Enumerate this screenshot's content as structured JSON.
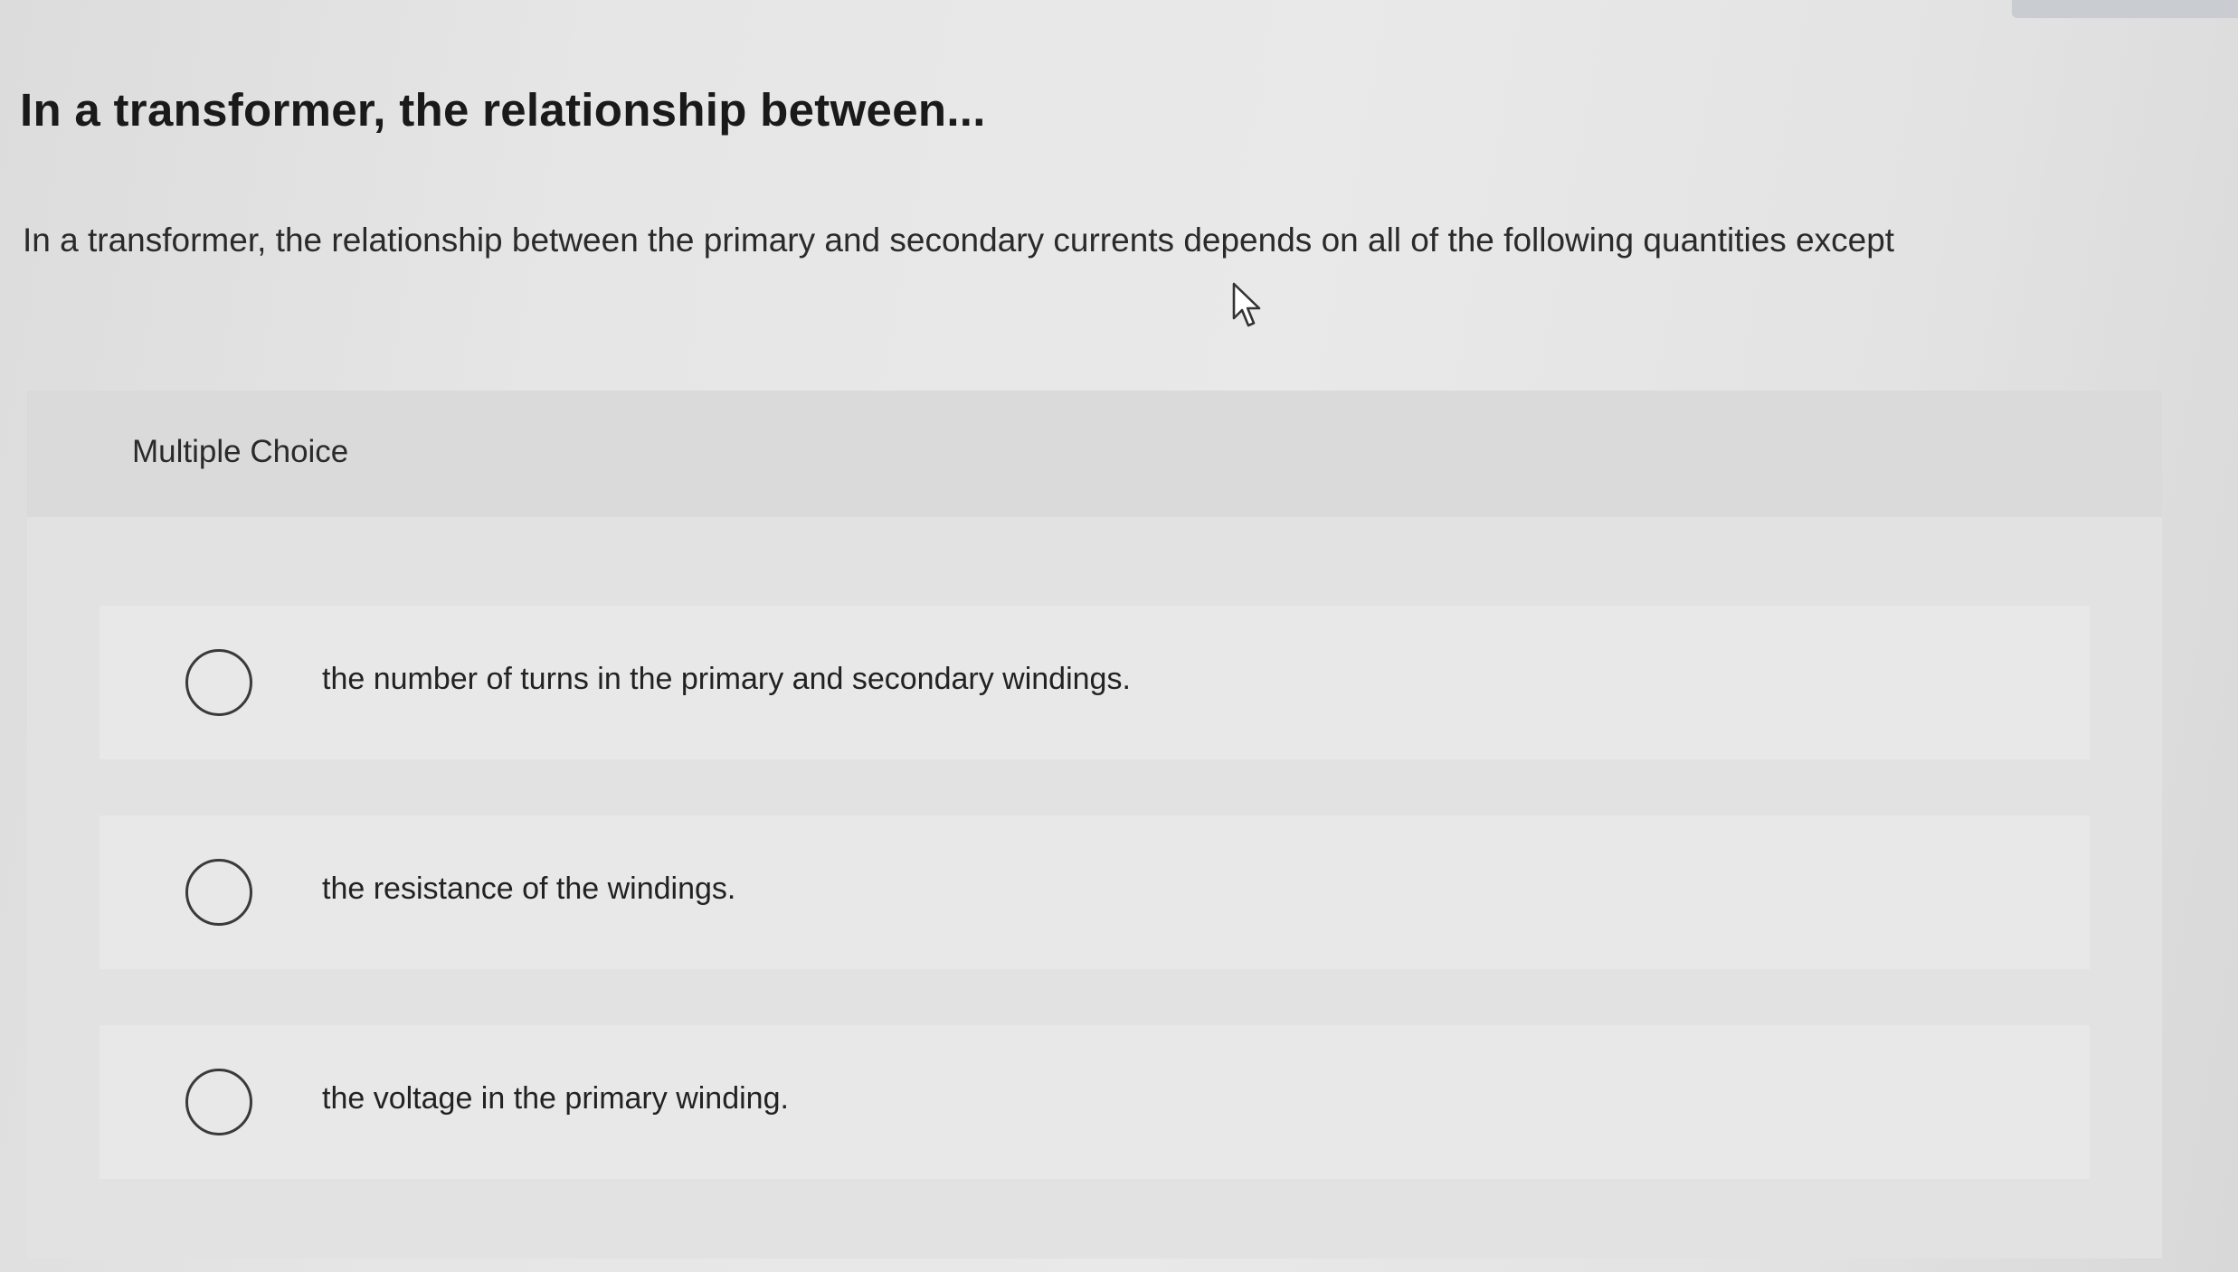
{
  "question": {
    "title": "In a transformer, the relationship between...",
    "prompt": "In a transformer, the relationship between the primary and secondary currents depends on all of the following quantities except"
  },
  "multiple_choice": {
    "label": "Multiple Choice",
    "options": [
      {
        "text": "the number of turns in the primary and secondary windings.",
        "selected": false
      },
      {
        "text": "the resistance of the windings.",
        "selected": false
      },
      {
        "text": "the voltage in the primary winding.",
        "selected": false
      }
    ]
  },
  "icons": {
    "cursor": "mouse-pointer-icon"
  }
}
